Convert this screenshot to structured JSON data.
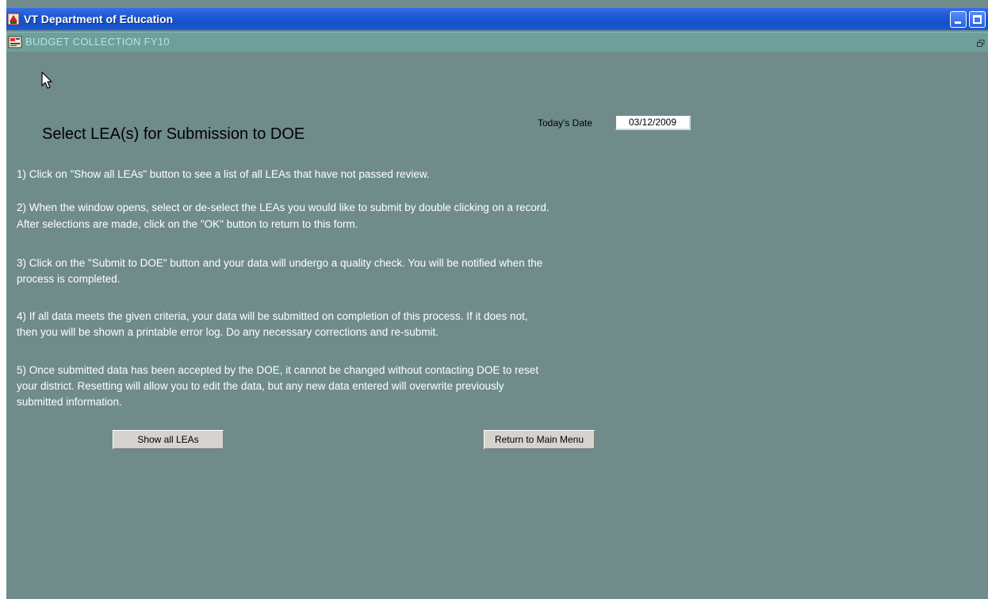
{
  "window": {
    "title": "VT Department of Education",
    "app_icon": "app-icon",
    "controls": {
      "minimize": "minimize-icon",
      "maximize": "maximize-icon"
    }
  },
  "form": {
    "title": "BUDGET COLLECTION FY10",
    "icon": "form-icon",
    "restore_icon": "restore-icon"
  },
  "page": {
    "heading": "Select LEA(s) for Submission to DOE",
    "date_label": "Today's Date",
    "date_value": "03/12/2009"
  },
  "instructions": {
    "step1": "1)  Click on \"Show all LEAs\" button to see a list of all LEAs that have not passed review.",
    "step2_line1": "2) When the window opens, select or de-select the LEAs you would like to submit by double clicking on a record.",
    "step2_line2": "    After selections are made, click on the \"OK\" button to return to this form.",
    "step3_line1": "3) Click on the \"Submit to DOE\"  button and your data will undergo a quality check.   You will be notified when the",
    "step3_line2": "    process is completed.",
    "step4_line1": "4) If all data meets the given criteria, your data will be submitted on completion of this process.  If it  does not,",
    "step4_line2": "    then you will be shown a printable error log.  Do any necessary corrections and re-submit.",
    "step5_line1": "5) Once submitted data has been accepted by the DOE, it cannot be changed without contacting DOE to reset",
    "step5_line2": "    your district.  Resetting will allow you to edit the data, but any new data entered will overwrite previously",
    "step5_line3": "    submitted information."
  },
  "buttons": {
    "show_all": "Show all LEAs",
    "return_main": "Return to Main Menu"
  },
  "colors": {
    "background": "#6f8c8b",
    "titlebar": "#1e5ad6",
    "form_bar": "#6f9f9a",
    "instruction_text": "#ffffff"
  }
}
